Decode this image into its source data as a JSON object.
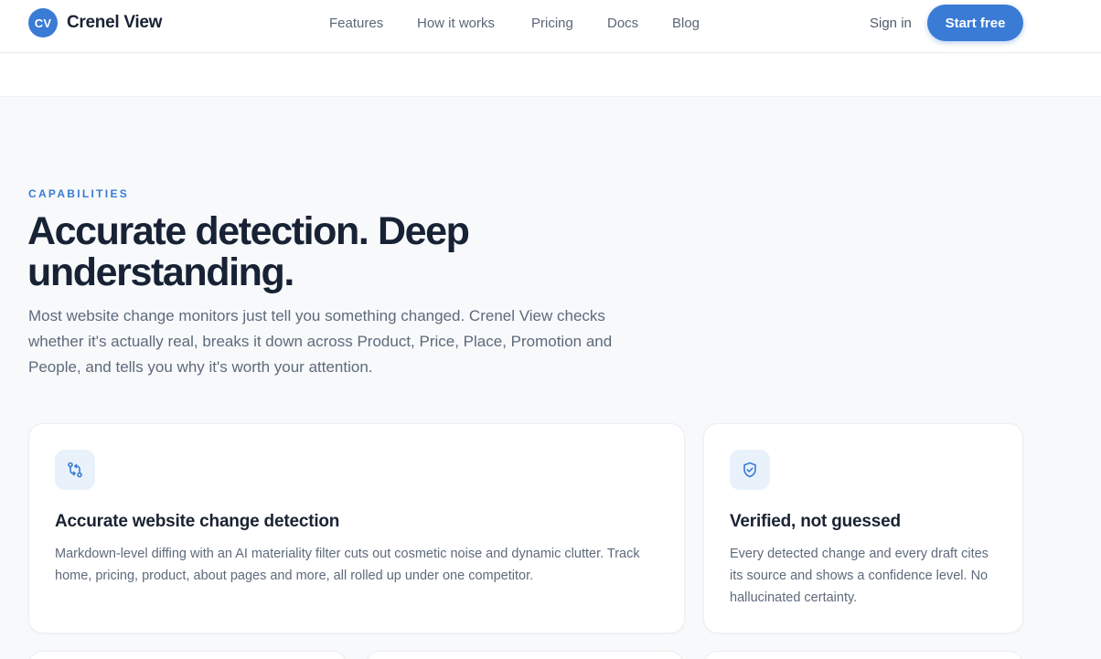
{
  "header": {
    "logo_initials": "CV",
    "brand": "Crenel View",
    "nav": [
      "Features",
      "How it works",
      "Pricing",
      "Docs",
      "Blog"
    ],
    "sign_in": "Sign in",
    "cta": "Start free"
  },
  "hero": {
    "eyebrow": "CAPABILITIES",
    "headline": "Accurate detection. Deep understanding.",
    "lead": "Most website change monitors just tell you something changed. Crenel View checks whether it's actually real, breaks it down across Product, Price, Place, Promotion and People, and tells you why it's worth your attention."
  },
  "cards": [
    {
      "icon": "compare-arrows-icon",
      "title": "Accurate website change detection",
      "body": "Markdown-level diffing with an AI materiality filter cuts out cosmetic noise and dynamic clutter. Track home, pricing, product, about pages and more, all rolled up under one competitor."
    },
    {
      "icon": "shield-check-icon",
      "title": "Verified, not guessed",
      "body": "Every detected change and every draft cites its source and shows a confidence level. No hallucinated certainty."
    }
  ],
  "colors": {
    "accent": "#3a7bd5",
    "heading": "#182235",
    "muted": "#5e6a7b",
    "background": "#f7f9fb"
  }
}
